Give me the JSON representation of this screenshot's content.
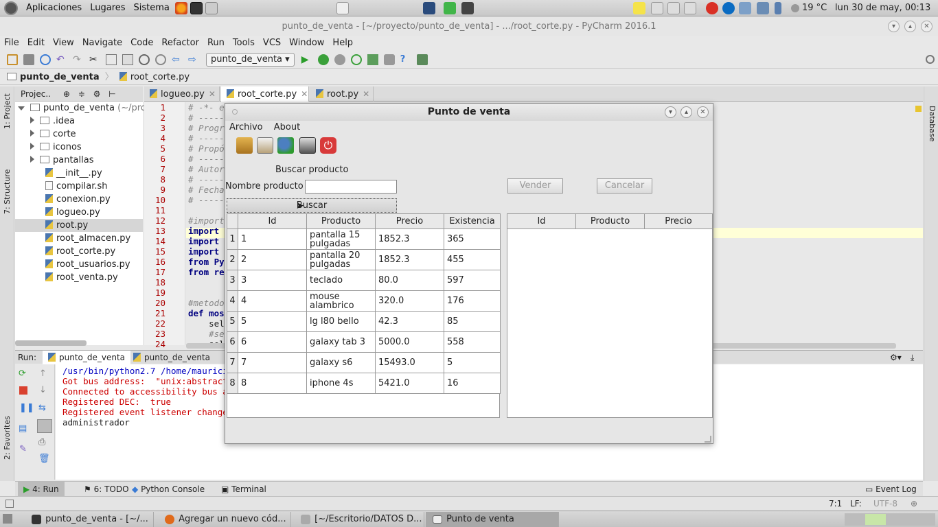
{
  "top_panel": {
    "menus": [
      "Aplicaciones",
      "Lugares",
      "Sistema"
    ],
    "weather": "19 °C",
    "clock": "lun 30 de may, 00:13"
  },
  "ide": {
    "window_title": "punto_de_venta - [~/proyecto/punto_de_venta] - .../root_corte.py - PyCharm 2016.1",
    "menu": [
      "File",
      "Edit",
      "View",
      "Navigate",
      "Code",
      "Refactor",
      "Run",
      "Tools",
      "VCS",
      "Window",
      "Help"
    ],
    "run_config": "punto_de_venta",
    "breadcrumb": {
      "project": "punto_de_venta",
      "file": "root_corte.py"
    },
    "left_strip": {
      "project": "1: Project",
      "structure": "7: Structure",
      "favorites": "2: Favorites"
    },
    "right_strip": {
      "database": "Database"
    },
    "project_panel": {
      "title": "Projec..",
      "tree": [
        {
          "label": "punto_de_venta",
          "suffix": "(~/pro",
          "type": "root"
        },
        {
          "label": ".idea",
          "type": "folder"
        },
        {
          "label": "corte",
          "type": "folder"
        },
        {
          "label": "iconos",
          "type": "folder"
        },
        {
          "label": "pantallas",
          "type": "folder"
        },
        {
          "label": "__init__.py",
          "type": "py"
        },
        {
          "label": "compilar.sh",
          "type": "sh"
        },
        {
          "label": "conexion.py",
          "type": "py"
        },
        {
          "label": "logueo.py",
          "type": "py"
        },
        {
          "label": "root.py",
          "type": "py",
          "selected": true
        },
        {
          "label": "root_almacen.py",
          "type": "py"
        },
        {
          "label": "root_corte.py",
          "type": "py"
        },
        {
          "label": "root_usuarios.py",
          "type": "py"
        },
        {
          "label": "root_venta.py",
          "type": "py"
        }
      ]
    },
    "editor_tabs": [
      {
        "label": "logueo.py",
        "active": false
      },
      {
        "label": "root_corte.py",
        "active": true
      },
      {
        "label": "root.py",
        "active": false
      }
    ],
    "line_numbers": [
      "1",
      "2",
      "3",
      "4",
      "5",
      "6",
      "7",
      "8",
      "9",
      "10",
      "11",
      "12",
      "13",
      "14",
      "15",
      "16",
      "17",
      "18",
      "19",
      "20",
      "21",
      "22",
      "23",
      "24"
    ],
    "code_lines": [
      {
        "t": "# -*- en",
        "c": "cm"
      },
      {
        "t": "# -----",
        "c": "cm"
      },
      {
        "t": "# Progra",
        "c": "cm"
      },
      {
        "t": "# -----",
        "c": "cm"
      },
      {
        "t": "# Propós",
        "c": "cm"
      },
      {
        "t": "# -----",
        "c": "cm"
      },
      {
        "t": "# Autor:",
        "c": "cm"
      },
      {
        "t": "# -----",
        "c": "cm"
      },
      {
        "t": "# Fecha:",
        "c": "cm"
      },
      {
        "t": "# -----",
        "c": "cm"
      },
      {
        "t": "",
        "c": ""
      },
      {
        "t": "#importa",
        "c": "cm"
      },
      {
        "t": "import t",
        "c": "kw"
      },
      {
        "t": "import c",
        "c": "kw"
      },
      {
        "t": "import c",
        "c": "kw"
      },
      {
        "t": "from PyQ",
        "c": "kw"
      },
      {
        "t": "from rep",
        "c": "kw"
      },
      {
        "t": "",
        "c": ""
      },
      {
        "t": "",
        "c": ""
      },
      {
        "t": "#metodo",
        "c": "cm"
      },
      {
        "t": "def mos",
        "c": "kw"
      },
      {
        "t": "    sel",
        "c": ""
      },
      {
        "t": "    #se",
        "c": "cm"
      },
      {
        "t": "    sel",
        "c": ""
      }
    ],
    "run_panel": {
      "label": "Run:",
      "tabs": [
        "punto_de_venta",
        "punto_de_venta"
      ],
      "console": [
        "/usr/bin/python2.7 /home/mauricio/",
        "Got bus address:  \"unix:abstract=/",
        "Connected to accessibility bus at:",
        "Registered DEC:  true",
        "Registered event listener change l",
        "administrador"
      ]
    },
    "bottom_tabs": {
      "run": "4: Run",
      "todo": "6: TODO",
      "python_console": "Python Console",
      "terminal": "Terminal",
      "event_log": "Event Log"
    },
    "status": {
      "position": "7:1",
      "line_sep": "LF:",
      "encoding": "UTF-8"
    }
  },
  "dialog": {
    "title": "Punto de venta",
    "menu": [
      "Archivo",
      "About"
    ],
    "search_title": "Buscar producto",
    "nombre_label": "Nombre producto",
    "nombre_value": "",
    "buscar_button": "Buscar",
    "vender_button": "Vender",
    "cancelar_button": "Cancelar",
    "products_table": {
      "headers": [
        "Id",
        "Producto",
        "Precio",
        "Existencia"
      ],
      "rows": [
        {
          "n": "1",
          "id": "1",
          "producto": "pantalla 15 pulgadas",
          "precio": "1852.3",
          "existencia": "365"
        },
        {
          "n": "2",
          "id": "2",
          "producto": "pantalla 20 pulgadas",
          "precio": "1852.3",
          "existencia": "455"
        },
        {
          "n": "3",
          "id": "3",
          "producto": "teclado",
          "precio": "80.0",
          "existencia": "597"
        },
        {
          "n": "4",
          "id": "4",
          "producto": "mouse alambrico",
          "precio": "320.0",
          "existencia": "176"
        },
        {
          "n": "5",
          "id": "5",
          "producto": "lg l80 bello",
          "precio": "42.3",
          "existencia": "85"
        },
        {
          "n": "6",
          "id": "6",
          "producto": "galaxy tab 3",
          "precio": "5000.0",
          "existencia": "558"
        },
        {
          "n": "7",
          "id": "7",
          "producto": "galaxy s6",
          "precio": "15493.0",
          "existencia": "5"
        },
        {
          "n": "8",
          "id": "8",
          "producto": "iphone 4s",
          "precio": "5421.0",
          "existencia": "16"
        }
      ]
    },
    "cart_table": {
      "headers": [
        "Id",
        "Producto",
        "Precio"
      ]
    }
  },
  "taskbar": [
    {
      "label": "punto_de_venta - [~/...",
      "active": false
    },
    {
      "label": "Agregar un nuevo cód...",
      "active": false
    },
    {
      "label": "[~/Escritorio/DATOS D...",
      "active": false
    },
    {
      "label": "Punto de venta",
      "active": true
    }
  ]
}
